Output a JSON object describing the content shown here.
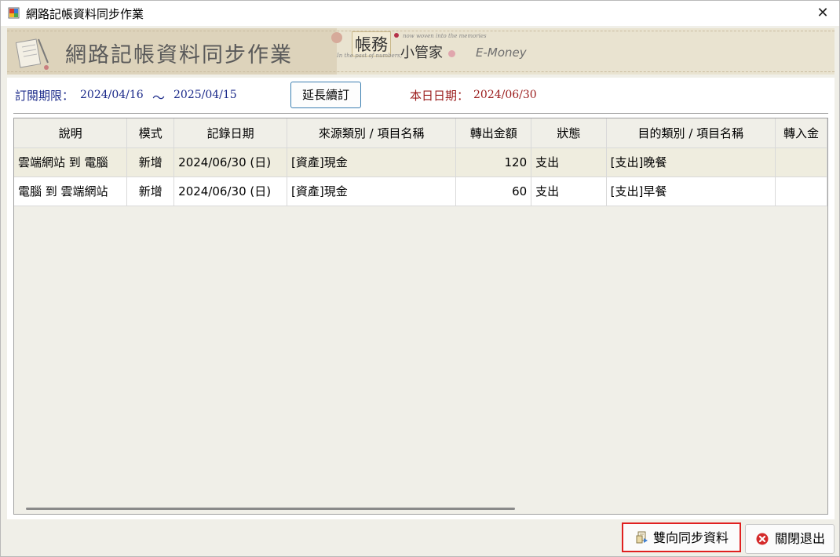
{
  "window": {
    "title": "網路記帳資料同步作業",
    "close_glyph": "✕"
  },
  "banner": {
    "title": "網路記帳資料同步作業",
    "brand_main": "帳務",
    "brand_sub": "小管家",
    "brand_tagline_top": "now woven into the memories",
    "brand_tagline_bottom": "In the past of numbers,",
    "brand_product": "E-Money"
  },
  "subscription": {
    "label": "訂閱期限：",
    "start": "2024/04/16",
    "tilde": "～",
    "end": "2025/04/15",
    "extend_button": "延長續訂",
    "today_label": "本日日期：",
    "today_value": "2024/06/30"
  },
  "grid": {
    "columns": [
      "說明",
      "模式",
      "記錄日期",
      "來源類別 / 項目名稱",
      "轉出金額",
      "狀態",
      "目的類別 / 項目名稱",
      "轉入金"
    ],
    "rows": [
      {
        "desc": "雲端網站 到 電腦",
        "mode": "新增",
        "date": "2024/06/30 (日)",
        "source": "[資產]現金",
        "amount": "120",
        "status": "支出",
        "dest": "[支出]晚餐",
        "in_amount": ""
      },
      {
        "desc": "電腦 到 雲端網站",
        "mode": "新增",
        "date": "2024/06/30 (日)",
        "source": "[資產]現金",
        "amount": "60",
        "status": "支出",
        "dest": "[支出]早餐",
        "in_amount": ""
      }
    ]
  },
  "footer": {
    "sync_button": "雙向同步資料",
    "close_button": "關閉退出"
  },
  "colors": {
    "subscription_text": "#1b2a8a",
    "today_text": "#9b1d1d",
    "highlight_border": "#e02020",
    "selected_row": "#efeddf"
  },
  "icons": {
    "app": "app-icon",
    "close": "close-icon",
    "sync": "sync-icon",
    "exit": "error-circle-icon"
  }
}
